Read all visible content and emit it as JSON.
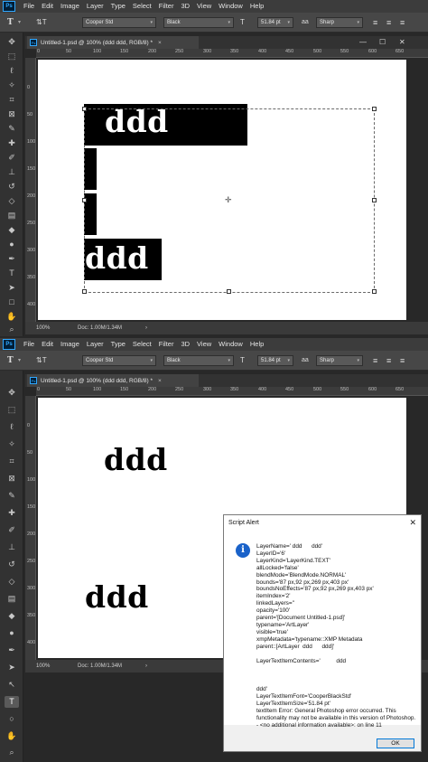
{
  "menu": [
    "File",
    "Edit",
    "Image",
    "Layer",
    "Type",
    "Select",
    "Filter",
    "3D",
    "View",
    "Window",
    "Help"
  ],
  "ps_logo": "Ps",
  "options": {
    "font_family": "Cooper Std",
    "font_style": "Black",
    "size_icon": "T",
    "font_size": "51.84 pt",
    "aa_icon": "aa",
    "antialias": "Sharp"
  },
  "top": {
    "tab_title": "Untitled-1.psd @ 100% (ddd      ddd, RGB/8) *",
    "h_ruler": [
      "0",
      "50",
      "100",
      "150",
      "200",
      "250",
      "300",
      "350",
      "400",
      "450",
      "500",
      "550",
      "600",
      "650"
    ],
    "v_ruler": [
      "0",
      "50",
      "100",
      "150",
      "200",
      "250",
      "300",
      "350",
      "400"
    ],
    "zoom": "100%",
    "doc": "Doc: 1.00M/1.34M",
    "text_top": "ddd",
    "text_bottom": "ddd"
  },
  "bottom": {
    "tab_title": "Untitled-1.psd @ 100% (ddd      ddd, RGB/8) *",
    "h_ruler": [
      "0",
      "50",
      "100",
      "150",
      "200",
      "250",
      "300",
      "350",
      "400",
      "450",
      "500",
      "550",
      "600",
      "650"
    ],
    "v_ruler": [
      "0",
      "50",
      "100",
      "150",
      "200",
      "250",
      "300",
      "350",
      "400"
    ],
    "zoom": "100%",
    "doc": "Doc: 1.00M/1.34M",
    "text_top": "ddd",
    "text_bottom": "ddd"
  },
  "alert": {
    "title": "Script Alert",
    "close": "✕",
    "icon": "i",
    "message": "LayerName=' ddd      ddd'\nLayerID='6'\nLayerKind='LayerKind.TEXT'\nallLocked='false'\nblendMode='BlendMode.NORMAL'\nbounds='87 px,92 px,269 px,403 px'\nboundsNoEffects='87 px,92 px,269 px,403 px'\nitemIndex='2'\nlinkedLayers=''\nopacity='100'\nparent='[Document Untitled-1.psd]'\ntypename='ArtLayer'\nvisible='true'\nxmpMetadata='typename::XMP Metadata\nparent::[ArtLayer  ddd      ddd]'\n\nLayerTextItemContents='          ddd\n\n\n\nddd'\nLayerTextItemFont='CooperBlackStd'\nLayerTextItemSize='51.84 pt'\ntextItem Error: General Photoshop error occurred. This functionality may not be available in this version of Photoshop.\n- <no additional information available>: on line 11",
    "ok": "OK"
  }
}
